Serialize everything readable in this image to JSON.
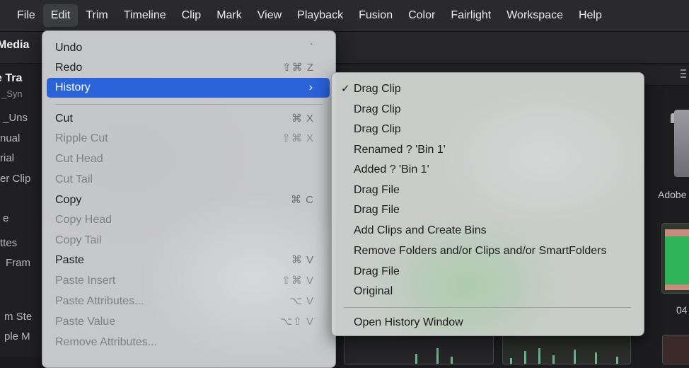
{
  "menubar": {
    "items": [
      "File",
      "Edit",
      "Trim",
      "Timeline",
      "Clip",
      "Mark",
      "View",
      "Playback",
      "Fusion",
      "Color",
      "Fairlight",
      "Workspace",
      "Help"
    ],
    "active": "Edit"
  },
  "background": {
    "left_labels": [
      "Media",
      "e Tra",
      "_Syn",
      "_Uns",
      "nual",
      "rial",
      "er Clip",
      "e",
      "ttes",
      "Fram",
      "m Ste",
      "ple M"
    ],
    "right_labels": [
      "Adobe",
      "04"
    ]
  },
  "edit_menu": {
    "items": [
      {
        "label": "Undo",
        "shortcut": "`",
        "state": "enabled"
      },
      {
        "label": "Redo",
        "shortcut": "⇧⌘ Z",
        "state": "enabled"
      },
      {
        "label": "History",
        "shortcut": "›",
        "state": "highlighted"
      },
      {
        "label": "Cut",
        "shortcut": "⌘ X",
        "state": "enabled"
      },
      {
        "label": "Ripple Cut",
        "shortcut": "⇧⌘ X",
        "state": "disabled"
      },
      {
        "label": "Cut Head",
        "shortcut": "",
        "state": "disabled"
      },
      {
        "label": "Cut Tail",
        "shortcut": "",
        "state": "disabled"
      },
      {
        "label": "Copy",
        "shortcut": "⌘ C",
        "state": "enabled"
      },
      {
        "label": "Copy Head",
        "shortcut": "",
        "state": "disabled"
      },
      {
        "label": "Copy Tail",
        "shortcut": "",
        "state": "disabled"
      },
      {
        "label": "Paste",
        "shortcut": "⌘ V",
        "state": "enabled"
      },
      {
        "label": "Paste Insert",
        "shortcut": "⇧⌘ V",
        "state": "disabled"
      },
      {
        "label": "Paste Attributes...",
        "shortcut": "⌥ V",
        "state": "disabled"
      },
      {
        "label": "Paste Value",
        "shortcut": "⌥⇧ V",
        "state": "disabled"
      },
      {
        "label": "Remove Attributes...",
        "shortcut": "",
        "state": "disabled"
      }
    ]
  },
  "history_submenu": {
    "items": [
      {
        "label": "Drag Clip",
        "checked": "✓"
      },
      {
        "label": "Drag Clip",
        "checked": ""
      },
      {
        "label": "Drag Clip",
        "checked": ""
      },
      {
        "label": "Renamed ? 'Bin 1'",
        "checked": ""
      },
      {
        "label": "Added ? 'Bin 1'",
        "checked": ""
      },
      {
        "label": "Drag File",
        "checked": ""
      },
      {
        "label": "Drag File",
        "checked": ""
      },
      {
        "label": "Add Clips and Create Bins",
        "checked": ""
      },
      {
        "label": "Remove Folders and/or Clips and/or SmartFolders",
        "checked": ""
      },
      {
        "label": "Drag File",
        "checked": ""
      },
      {
        "label": "Original",
        "checked": ""
      }
    ],
    "footer": "Open History Window"
  },
  "colors": {
    "highlight": "#2a62d9",
    "menubar_bg": "#2a2a2d",
    "menu_bg": "#cdced0"
  }
}
